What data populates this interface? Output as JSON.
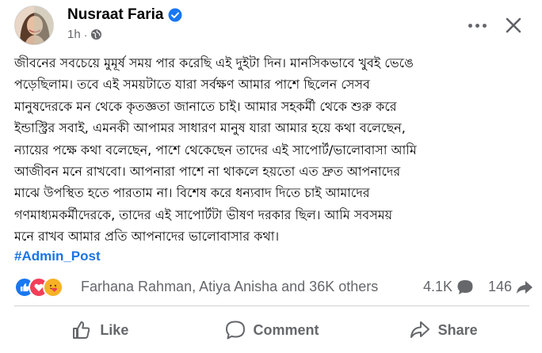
{
  "post": {
    "author": "Nusraat Faria",
    "time": "1h",
    "separator": "·",
    "text_lines": [
      "জীবনের সবচেয়ে মুমূর্ষ সময় পার করেছি এই দুইটা দিন। মানসিকভাবে খুবই ভেঙে",
      "পড়েছিলাম। তবে এই সময়টাতে যারা সর্বক্ষণ আমার পাশে ছিলেন সেসব",
      "মানুষদেরকে মন থেকে কৃতজ্ঞতা জানাতে চাই। আমার সহকর্মী থেকে শুরু করে",
      "ইন্ডাস্ট্রির সবাই, এমনকী আপামর সাধারণ মানুষ যারা আমার হয়ে কথা বলেছেন,",
      "ন্যায়ের পক্ষে কথা বলেছেন, পাশে থেকেছেন তাদের এই সাপোর্ট/ভালোবাসা আমি",
      "আজীবন মনে রাখবো। আপনারা পাশে না থাকলে হয়তো এত দ্রুত আপনাদের",
      "মাঝে উপস্থিত হতে পারতাম না। বিশেষ করে ধন্যবাদ দিতে চাই আমাদের",
      "গণমাধ্যমকর্মীদেরকে, তাদের এই সাপোর্টটা ভীষণ দরকার ছিল। আমি সবসময়",
      "মনে রাখব আমার প্রতি আপনাদের ভালোবাসার কথা।"
    ],
    "hashtag": "#Admin_Post"
  },
  "engagement": {
    "reactions": [
      "like",
      "love",
      "care"
    ],
    "reactors_text": "Farhana Rahman, Atiya Anisha and 36K others",
    "comments": "4.1K",
    "shares": "146"
  },
  "actions": {
    "like": "Like",
    "comment": "Comment",
    "share": "Share"
  },
  "colors": {
    "link": "#1b74e4",
    "secondary_text": "#65676b",
    "verified": "#1877f2",
    "like": "#1877f2",
    "love": "#f33e58",
    "care": "#f7b125"
  },
  "icons": {
    "verified": "verified-badge-icon",
    "audience": "globe-icon",
    "more": "more-options-icon",
    "close": "close-icon",
    "comment_count": "comment-bubble-icon",
    "share_count": "share-arrow-icon",
    "like_action": "thumbs-up-icon",
    "comment_action": "comment-icon",
    "share_action": "share-icon"
  }
}
